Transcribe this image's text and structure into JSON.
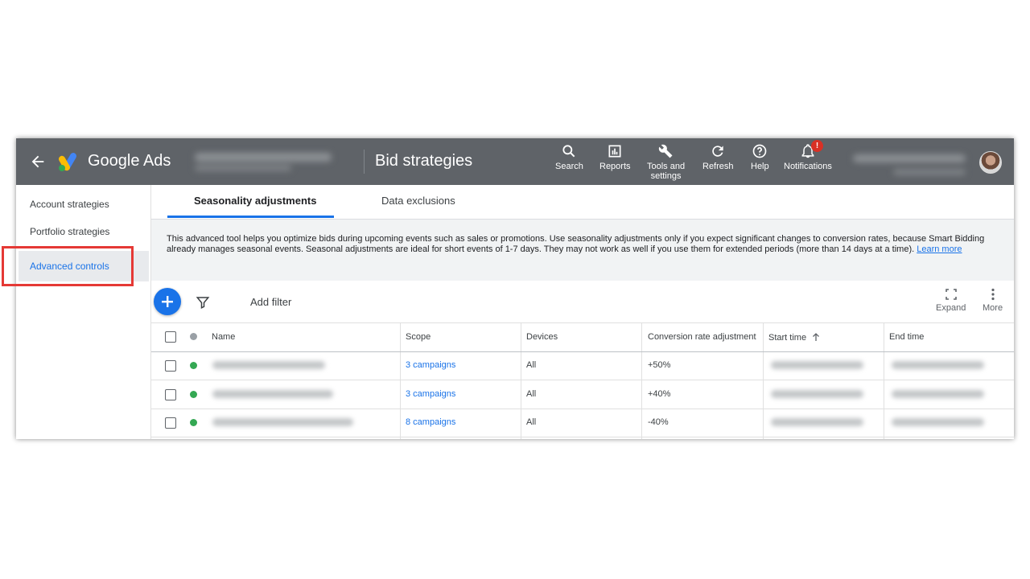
{
  "topbar": {
    "app_name": "Google Ads",
    "page_title": "Bid strategies",
    "nav": [
      {
        "label": "Search",
        "icon": "search-icon"
      },
      {
        "label": "Reports",
        "icon": "reports-icon"
      },
      {
        "label": "Tools and",
        "label2": "settings",
        "icon": "wrench-icon"
      },
      {
        "label": "Refresh",
        "icon": "refresh-icon"
      },
      {
        "label": "Help",
        "icon": "help-icon"
      },
      {
        "label": "Notifications",
        "icon": "bell-icon",
        "badge": "!"
      }
    ]
  },
  "sidebar": {
    "items": [
      {
        "label": "Account strategies"
      },
      {
        "label": "Portfolio strategies"
      },
      {
        "label": "Advanced controls",
        "active": true
      }
    ]
  },
  "tabs": [
    {
      "label": "Seasonality adjustments",
      "active": true
    },
    {
      "label": "Data exclusions"
    }
  ],
  "banner": {
    "text": "This advanced tool helps you optimize bids during upcoming events such as sales or promotions. Use seasonality adjustments only if you expect significant changes to conversion rates, because Smart Bidding already manages seasonal events. Seasonal adjustments are ideal for short events of 1-7 days. They may not work as well if you use them for extended periods (more than 14 days at a time). ",
    "link": "Learn more"
  },
  "toolbar": {
    "add_filter": "Add filter",
    "expand": "Expand",
    "more": "More"
  },
  "table": {
    "columns": [
      "Name",
      "Scope",
      "Devices",
      "Conversion rate adjustment",
      "Start time",
      "End time"
    ],
    "rows": [
      {
        "scope": "3 campaigns",
        "devices": "All",
        "adjustment": "+50%"
      },
      {
        "scope": "3 campaigns",
        "devices": "All",
        "adjustment": "+40%"
      },
      {
        "scope": "8 campaigns",
        "devices": "All",
        "adjustment": "-40%"
      }
    ]
  },
  "colors": {
    "topbar": "#5f6368",
    "accent": "#1a73e8",
    "status_enabled": "#34a853",
    "highlight": "#e53935"
  }
}
